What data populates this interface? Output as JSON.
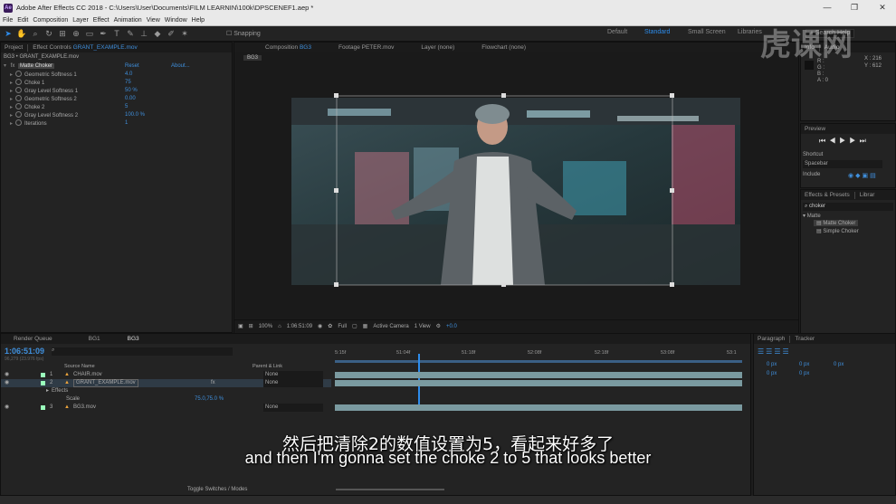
{
  "app": {
    "title": "Adobe After Effects CC 2018 - C:\\Users\\User\\Documents\\FILM LEARNIN\\100k\\DPSCENEF1.aep *",
    "menu": [
      "File",
      "Edit",
      "Composition",
      "Layer",
      "Effect",
      "Animation",
      "View",
      "Window",
      "Help"
    ],
    "window_controls": [
      "—",
      "❐",
      "✕"
    ]
  },
  "toolbar": {
    "snapping": "Snapping",
    "workspaces": [
      "Default",
      "Standard",
      "Small Screen",
      "Libraries"
    ],
    "active_workspace": "Standard",
    "search_help": "Search Help"
  },
  "project_panel": {
    "tabs": [
      "Project",
      "Effect Controls",
      "GRANT_EXAMPLE.mov"
    ],
    "breadcrumb": "BG3 • GRANT_EXAMPLE.mov",
    "effect": {
      "name": "Matte Choker",
      "reset": "Reset",
      "about": "About..."
    },
    "properties": [
      {
        "label": "Geometric Softness 1",
        "value": "4.0"
      },
      {
        "label": "Choke 1",
        "value": "75"
      },
      {
        "label": "Gray Level Softness 1",
        "value": "50 %"
      },
      {
        "label": "Geometric Softness 2",
        "value": "0.00"
      },
      {
        "label": "Choke 2",
        "value": "5"
      },
      {
        "label": "Gray Level Softness 2",
        "value": "100.0 %"
      },
      {
        "label": "Iterations",
        "value": "1"
      }
    ]
  },
  "viewer": {
    "tabs": [
      "Composition",
      "BG3",
      "Footage",
      "PETER.mov",
      "Layer",
      "(none)",
      "Flowchart",
      "(none)"
    ],
    "comp_tab": "BG3",
    "zoom": "100%",
    "timecode": "1:06:51:09",
    "resolution": "Full",
    "camera": "Active Camera",
    "views": "1 View",
    "exposure": "+0.0"
  },
  "info_panel": {
    "labels": [
      "Info",
      "Audio"
    ],
    "x": "X : 216",
    "y": "Y : 612",
    "channels": [
      "R :",
      "G :",
      "B :",
      "A : 0"
    ]
  },
  "preview_panel": {
    "title": "Preview",
    "shortcut_label": "Shortcut",
    "shortcut_value": "Spacebar",
    "include_label": "Include"
  },
  "effects_presets": {
    "tabs": [
      "Effects & Presets",
      "Librar"
    ],
    "search": "choker",
    "category": "Matte",
    "items": [
      "Matte Choker",
      "Simple Choker"
    ]
  },
  "timeline": {
    "tabs": [
      "Render Queue",
      "BG1",
      "BG3"
    ],
    "timecode": "1:06:51:09",
    "frame_info": "96,279 (23.976 fps)",
    "column_source": "Source Name",
    "column_parent": "Parent & Link",
    "ruler": [
      "5:15f",
      "51:04f",
      "51:18f",
      "52:08f",
      "52:18f",
      "53:08f",
      "53:1"
    ],
    "layers": [
      {
        "num": "1",
        "name": "CHAIR.mov",
        "parent": "None"
      },
      {
        "num": "2",
        "name": "GRANT_EXAMPLE.mov",
        "parent": "None"
      },
      {
        "num": "3",
        "name": "BG3.mov",
        "parent": "None"
      }
    ],
    "effects_label": "Effects",
    "scale_label": "Scale",
    "scale_value": "75.0,75.0 %",
    "toggle": "Toggle Switches / Modes"
  },
  "paragraph_panel": {
    "tabs": [
      "Paragraph",
      "Tracker"
    ],
    "fields": [
      "0 px",
      "0 px",
      "0 px",
      "0 px",
      "0 px"
    ]
  },
  "subtitle": {
    "zh": "然后把清除2的数值设置为5，看起来好多了",
    "en": "and then I'm gonna set the choke 2 to 5 that looks better"
  },
  "watermark": "虎课网",
  "colors": {
    "accent": "#2d8ceb",
    "panel": "#232323",
    "bar": "#7a9aa0"
  }
}
